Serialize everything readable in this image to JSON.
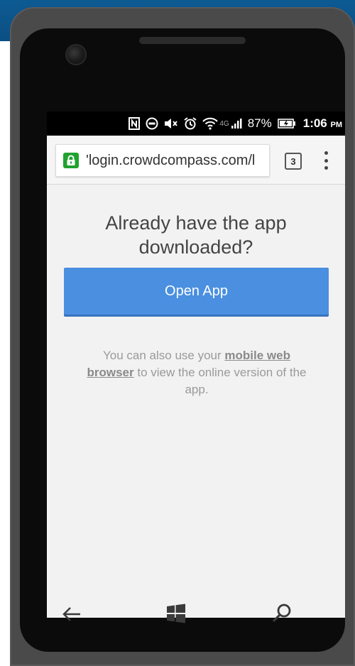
{
  "status_bar": {
    "battery_percent": "87%",
    "time": "1:06",
    "ampm": "PM",
    "network_type": "4G",
    "icons": [
      "nfc-icon",
      "do-not-disturb-icon",
      "mute-icon",
      "alarm-icon",
      "wifi-icon",
      "signal-icon",
      "battery-icon"
    ]
  },
  "browser": {
    "url": "'login.crowdcompass.com/l",
    "tab_count": "3"
  },
  "page": {
    "heading": "Already have the app downloaded?",
    "open_button": "Open App",
    "sub_text_before": "You can also use your ",
    "sub_text_link": "mobile web browser",
    "sub_text_after": " to view the online version of the app."
  },
  "colors": {
    "button": "#4a8fe0",
    "lock": "#1fa22f",
    "background_top": "#0d5a92"
  },
  "navigation": {
    "icons": [
      "back-arrow-icon",
      "windows-start-icon",
      "search-icon"
    ]
  }
}
